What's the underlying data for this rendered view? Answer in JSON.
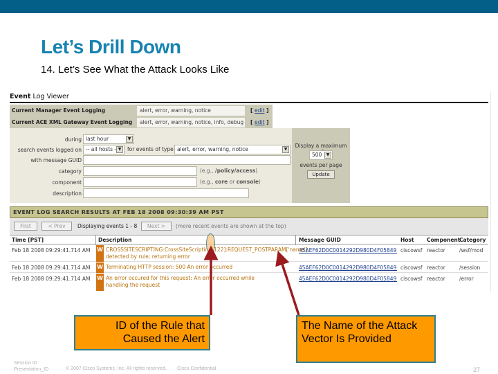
{
  "slide": {
    "title": "Let’s Drill Down",
    "subtitle": "14. Let’s See What the Attack Looks Like",
    "accent_color": "#035f87",
    "title_color": "#1883b1"
  },
  "viewer": {
    "title_bold": "Event",
    "title_rest": " Log Viewer",
    "current_logging": [
      {
        "label": "Current Manager Event Logging",
        "value": "alert, error, warning, notice",
        "edit": "edit"
      },
      {
        "label": "Current ACE XML Gateway Event Logging",
        "value": "alert, error, warning, notice, info, debug",
        "edit": "edit"
      }
    ],
    "search": {
      "during_label": "during",
      "during_value": "last hour",
      "hosts_label": "search events logged on",
      "hosts_value": "-- all hosts --",
      "type_label": "for events of type",
      "type_value": "alert, error, warning, notice",
      "guid_label": "with message GUID",
      "guid_value": "",
      "category_label": "category",
      "category_value": "",
      "category_hint_pre": "(e.g., ",
      "category_hint_bold": "/policy/access",
      "category_hint_post": ")",
      "component_label": "component",
      "component_value": "",
      "component_hint_pre": "(e.g., ",
      "component_hint_bold1": "core",
      "component_hint_mid": " or ",
      "component_hint_bold2": "console",
      "component_hint_post": ")",
      "description_label": "description",
      "description_value": ""
    },
    "display_max": {
      "label_top": "Display a maximum of",
      "value": "500",
      "label_bottom": "events per page",
      "update_label": "Update"
    },
    "results": {
      "header": "EVENT LOG SEARCH RESULTS AT FEB 18 2008 09:30:39 AM PST",
      "first_label": "First",
      "prev_label": "< Prev",
      "displaying": "Displaying events 1 - 8",
      "next_label": "Next >",
      "note": "(more recent events are shown at the top)",
      "columns": [
        "Time [PST]",
        "Description",
        "Message GUID",
        "Host",
        "Component",
        "Category"
      ],
      "rows": [
        {
          "time": "Feb 18 2008 09:29:41.714 AM",
          "level": "W",
          "description": "CROSSSITESCRIPTING:CrossSiteScripting[122]:REQUEST_POSTPARAM['name'] detected by rule; returning error",
          "guid": "45AEF62D0C0014292D980D4F05849E2D",
          "host": "ciscowsf",
          "component": "reactor",
          "category": "/wsf/mod"
        },
        {
          "time": "Feb 18 2008 09:29:41.714 AM",
          "level": "W",
          "description": "Terminating HTTP session: 500 An error occurred",
          "guid": "45AEF62D0C0014292D980D4F05849E2D",
          "host": "ciscowsf",
          "component": "reactor",
          "category": "/session"
        },
        {
          "time": "Feb 18 2008 09:29:41.714 AM",
          "level": "W",
          "description": "An error occured for this request: An error occurred while handling the request",
          "guid": "45AEF62D0C0014292D980D4F05849E2D",
          "host": "ciscowsf",
          "component": "reactor",
          "category": "/error"
        }
      ]
    }
  },
  "callouts": {
    "left": "ID of the Rule that Caused the Alert",
    "right": "The Name of the Attack Vector Is Provided",
    "fill_color": "#ff9900",
    "arrow_color": "#9b1b1f"
  },
  "footer": {
    "session": "Session ID",
    "presentation": "Presentation_ID",
    "copyright": "© 2007 Cisco Systems, Inc. All rights reserved.",
    "confidential": "Cisco Confidential",
    "page": "27"
  }
}
